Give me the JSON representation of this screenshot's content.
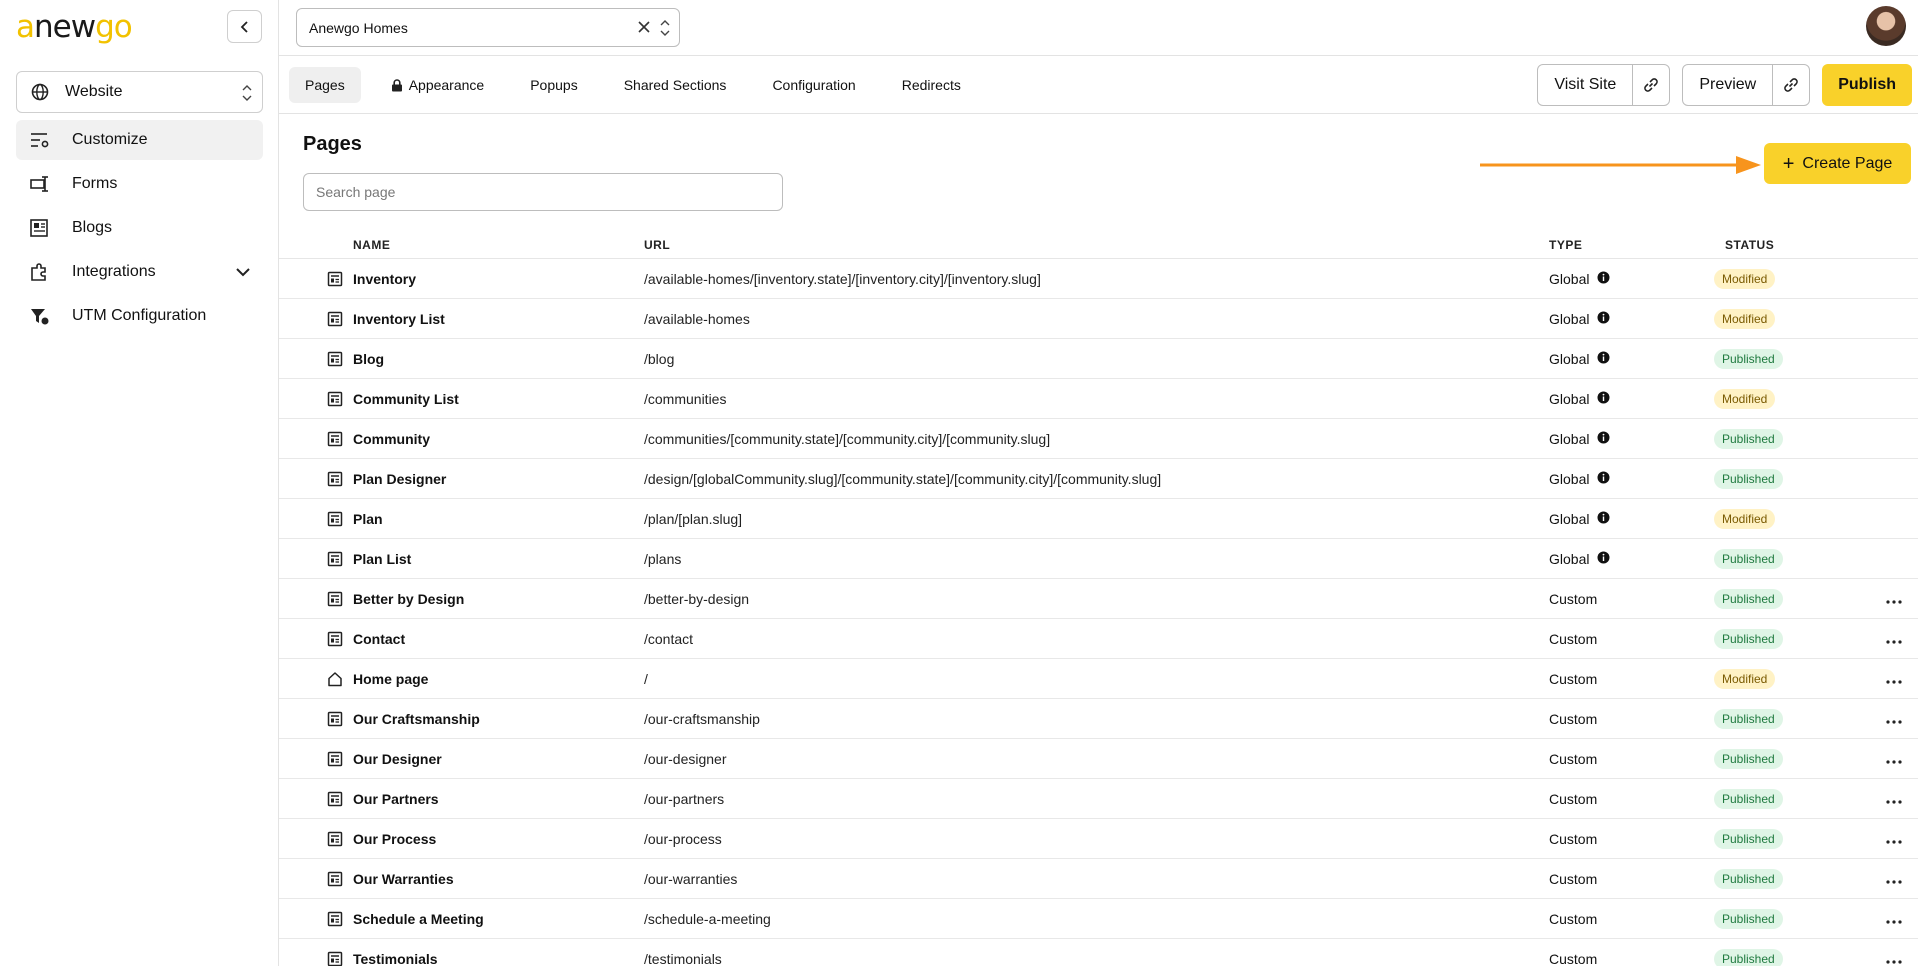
{
  "brand": {
    "logo_a": "a",
    "logo_new": "new",
    "logo_go": "go"
  },
  "sidebar": {
    "site_select": "Website",
    "items": [
      {
        "label": "Customize",
        "icon": "sliders-icon"
      },
      {
        "label": "Forms",
        "icon": "form-input-icon"
      },
      {
        "label": "Blogs",
        "icon": "newspaper-icon"
      },
      {
        "label": "Integrations",
        "icon": "puzzle-icon"
      },
      {
        "label": "UTM Configuration",
        "icon": "filter-icon"
      }
    ]
  },
  "topbar": {
    "project": "Anewgo Homes"
  },
  "tabs": [
    "Pages",
    "Appearance",
    "Popups",
    "Shared Sections",
    "Configuration",
    "Redirects"
  ],
  "actions": {
    "visit": "Visit Site",
    "preview": "Preview",
    "publish": "Publish"
  },
  "main": {
    "title": "Pages",
    "search_placeholder": "Search page",
    "create_label": "Create Page",
    "columns": {
      "name": "NAME",
      "url": "URL",
      "type": "TYPE",
      "status": "STATUS"
    },
    "rows": [
      {
        "name": "Inventory",
        "url": "/available-homes/[inventory.state]/[inventory.city]/[inventory.slug]",
        "type": "Global",
        "status": "Modified",
        "icon": "page-icon"
      },
      {
        "name": "Inventory List",
        "url": "/available-homes",
        "type": "Global",
        "status": "Modified",
        "icon": "page-icon"
      },
      {
        "name": "Blog",
        "url": "/blog",
        "type": "Global",
        "status": "Published",
        "icon": "page-icon"
      },
      {
        "name": "Community List",
        "url": "/communities",
        "type": "Global",
        "status": "Modified",
        "icon": "page-icon"
      },
      {
        "name": "Community",
        "url": "/communities/[community.state]/[community.city]/[community.slug]",
        "type": "Global",
        "status": "Published",
        "icon": "page-icon"
      },
      {
        "name": "Plan Designer",
        "url": "/design/[globalCommunity.slug]/[community.state]/[community.city]/[community.slug]",
        "type": "Global",
        "status": "Published",
        "icon": "page-icon"
      },
      {
        "name": "Plan",
        "url": "/plan/[plan.slug]",
        "type": "Global",
        "status": "Modified",
        "icon": "page-icon"
      },
      {
        "name": "Plan List",
        "url": "/plans",
        "type": "Global",
        "status": "Published",
        "icon": "page-icon"
      },
      {
        "name": "Better by Design",
        "url": "/better-by-design",
        "type": "Custom",
        "status": "Published",
        "icon": "page-icon"
      },
      {
        "name": "Contact",
        "url": "/contact",
        "type": "Custom",
        "status": "Published",
        "icon": "page-icon"
      },
      {
        "name": "Home page",
        "url": "/",
        "type": "Custom",
        "status": "Modified",
        "icon": "home-icon"
      },
      {
        "name": "Our Craftsmanship",
        "url": "/our-craftsmanship",
        "type": "Custom",
        "status": "Published",
        "icon": "page-icon"
      },
      {
        "name": "Our Designer",
        "url": "/our-designer",
        "type": "Custom",
        "status": "Published",
        "icon": "page-icon"
      },
      {
        "name": "Our Partners",
        "url": "/our-partners",
        "type": "Custom",
        "status": "Published",
        "icon": "page-icon"
      },
      {
        "name": "Our Process",
        "url": "/our-process",
        "type": "Custom",
        "status": "Published",
        "icon": "page-icon"
      },
      {
        "name": "Our Warranties",
        "url": "/our-warranties",
        "type": "Custom",
        "status": "Published",
        "icon": "page-icon"
      },
      {
        "name": "Schedule a Meeting",
        "url": "/schedule-a-meeting",
        "type": "Custom",
        "status": "Published",
        "icon": "page-icon"
      },
      {
        "name": "Testimonials",
        "url": "/testimonials",
        "type": "Custom",
        "status": "Published",
        "icon": "page-icon"
      }
    ]
  },
  "colors": {
    "accent": "#f9d12a",
    "arrow": "#f7941d",
    "modified_bg": "#fff2c5",
    "published_bg": "#dff5e6"
  }
}
